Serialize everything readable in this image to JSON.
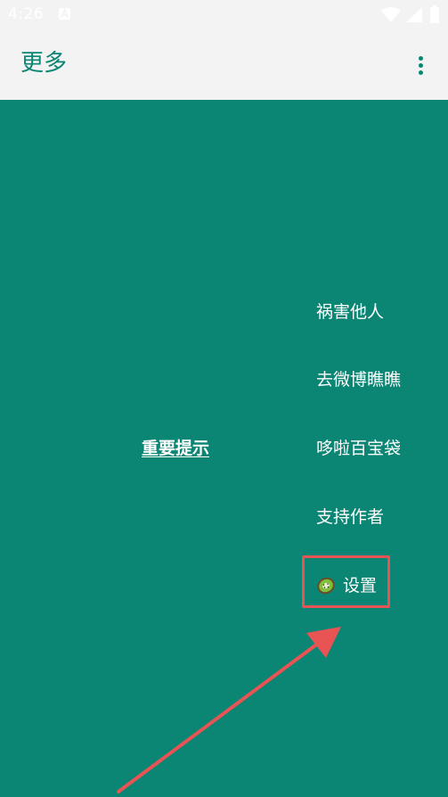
{
  "status_bar": {
    "time": "4:26",
    "icons": [
      "notification-a-icon",
      "wifi-icon",
      "signal-icon",
      "battery-icon"
    ]
  },
  "app_bar": {
    "title": "更多",
    "overflow_icon": "more-vert-icon"
  },
  "main": {
    "important_link": "重要提示",
    "menu_items": [
      {
        "label": "祸害他人"
      },
      {
        "label": "去微博瞧瞧"
      },
      {
        "label": "哆啦百宝袋"
      },
      {
        "label": "支持作者"
      }
    ],
    "settings": {
      "label": "设置",
      "icon": "kiwi-icon"
    }
  },
  "annotation": {
    "highlight_color": "#e85454",
    "arrow_icon": "arrow-annotation"
  },
  "colors": {
    "primary": "#0b8574",
    "bar_background": "#f3f3f3",
    "text_light": "#ffffff"
  }
}
